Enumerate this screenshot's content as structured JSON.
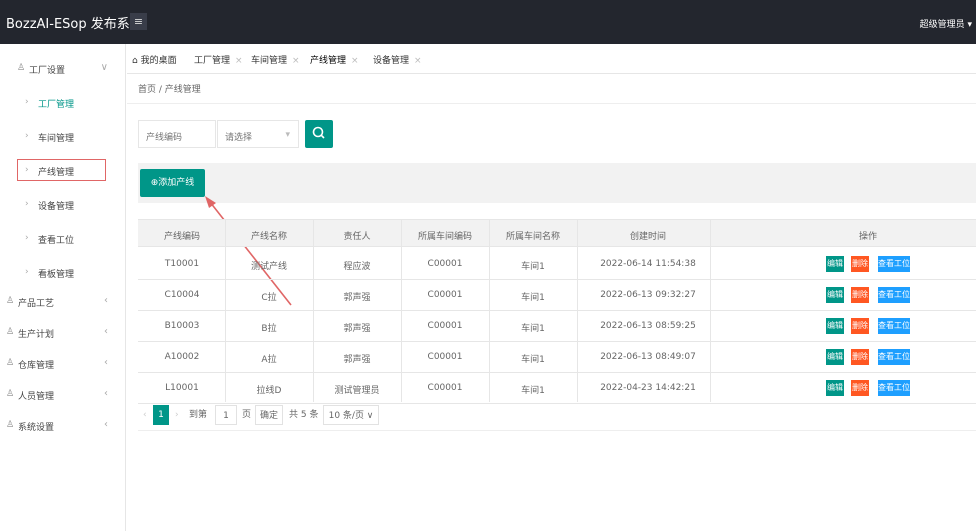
{
  "header": {
    "app_title": "BozzAI-ESop 发布系统",
    "menu_toggle_icon": "hamburger-icon",
    "user_label": "超级管理员 ▾"
  },
  "sidebar": {
    "items": [
      {
        "label": "工厂设置",
        "type": "group",
        "expanded": true
      },
      {
        "label": "工厂管理",
        "type": "child",
        "active": true
      },
      {
        "label": "车间管理",
        "type": "child"
      },
      {
        "label": "产线管理",
        "type": "child",
        "selected": true
      },
      {
        "label": "设备管理",
        "type": "child"
      },
      {
        "label": "查看工位",
        "type": "child"
      },
      {
        "label": "看板管理",
        "type": "child"
      },
      {
        "label": "产品工艺",
        "type": "group"
      },
      {
        "label": "生产计划",
        "type": "group"
      },
      {
        "label": "仓库管理",
        "type": "group"
      },
      {
        "label": "人员管理",
        "type": "group"
      },
      {
        "label": "系统设置",
        "type": "group"
      }
    ]
  },
  "tabs": [
    {
      "label": "我的桌面",
      "icon": "home-icon"
    },
    {
      "label": "工厂管理"
    },
    {
      "label": "车间管理"
    },
    {
      "label": "产线管理",
      "active": true
    },
    {
      "label": "设备管理"
    }
  ],
  "breadcrumb": "首页 / 产线管理",
  "search": {
    "code_placeholder": "产线编码",
    "select_placeholder": "请选择",
    "search_icon": "search-icon"
  },
  "toolbar": {
    "add_label": "添加产线",
    "add_icon": "plus-circle-icon"
  },
  "table": {
    "columns": [
      "产线编码",
      "产线名称",
      "责任人",
      "所属车间编码",
      "所属车间名称",
      "创建时间",
      "操作"
    ],
    "rows": [
      [
        "T10001",
        "测试产线",
        "程应波",
        "C00001",
        "车间1",
        "2022-06-14 11:54:38"
      ],
      [
        "C10004",
        "C拉",
        "郭声强",
        "C00001",
        "车间1",
        "2022-06-13 09:32:27"
      ],
      [
        "B10003",
        "B拉",
        "郭声强",
        "C00001",
        "车间1",
        "2022-06-13 08:59:25"
      ],
      [
        "A10002",
        "A拉",
        "郭声强",
        "C00001",
        "车间1",
        "2022-06-13 08:49:07"
      ],
      [
        "L10001",
        "拉线D",
        "测试管理员",
        "C00001",
        "车间1",
        "2022-04-23 14:42:21"
      ]
    ],
    "actions": {
      "edit": "编辑",
      "delete": "删除",
      "view": "查看工位"
    }
  },
  "pagination": {
    "current_page": "1",
    "goto_label": "到第",
    "goto_value": "1",
    "page_unit": "页",
    "confirm_label": "确定",
    "total_label": "共 5 条",
    "page_size": "10 条/页 ∨"
  },
  "colors": {
    "topbar": "#23262e",
    "accent": "#009688",
    "danger": "#ff5722",
    "info": "#1e9fff",
    "annotation": "#e06666"
  }
}
